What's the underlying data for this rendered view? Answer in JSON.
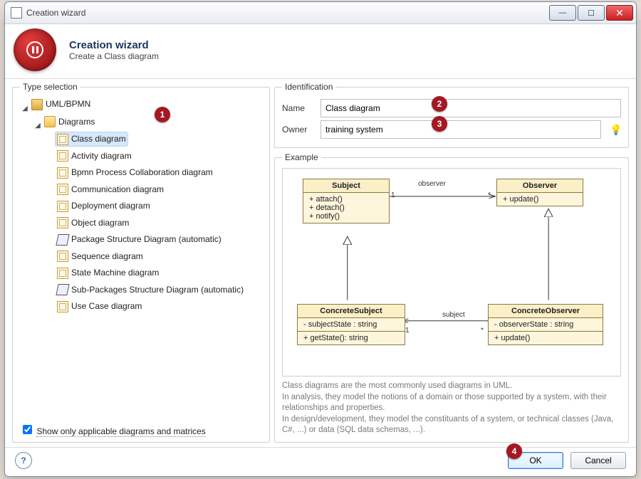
{
  "window": {
    "title": "Creation wizard"
  },
  "header": {
    "title": "Creation wizard",
    "subtitle": "Create a Class diagram"
  },
  "tree": {
    "legend": "Type selection",
    "root": "UML/BPMN",
    "group": "Diagrams",
    "items": [
      "Class diagram",
      "Activity diagram",
      "Bpmn Process Collaboration diagram",
      "Communication diagram",
      "Deployment diagram",
      "Object diagram",
      "Package Structure Diagram (automatic)",
      "Sequence diagram",
      "State Machine diagram",
      "Sub-Packages Structure Diagram (automatic)",
      "Use Case diagram"
    ],
    "struct_indices": [
      6,
      9
    ],
    "selected_index": 0,
    "filter_label": "Show only applicable diagrams and matrices",
    "filter_checked": true
  },
  "ident": {
    "legend": "Identification",
    "name_label": "Name",
    "name_value": "Class diagram",
    "owner_label": "Owner",
    "owner_value": "training system"
  },
  "example": {
    "legend": "Example",
    "subject": {
      "title": "Subject",
      "ops": "+ attach()\n+ detach()\n+ notify()"
    },
    "observer": {
      "title": "Observer",
      "ops": "+ update()"
    },
    "csubject": {
      "title": "ConcreteSubject",
      "attrs": "- subjectState : string",
      "ops": "+ getState(): string"
    },
    "cobserver": {
      "title": "ConcreteObserver",
      "attrs": "- observerState : string",
      "ops": "+ update()"
    },
    "assoc_observer": {
      "name": "observer",
      "m1": "1",
      "m2": "*"
    },
    "assoc_subject": {
      "name": "subject",
      "m1": "1",
      "m2": "*"
    },
    "description": [
      "Class diagrams are the most commonly used diagrams in UML.",
      "In analysis, they model the notions of a domain or those supported by a system, with their relationships and properties.",
      "In design/development, they model the constituants of a system, or technical classes (Java, C#, ...) or data (SQL data schemas, ...)."
    ]
  },
  "footer": {
    "ok": "OK",
    "cancel": "Cancel"
  },
  "badges": {
    "b1": "1",
    "b2": "2",
    "b3": "3",
    "b4": "4"
  }
}
